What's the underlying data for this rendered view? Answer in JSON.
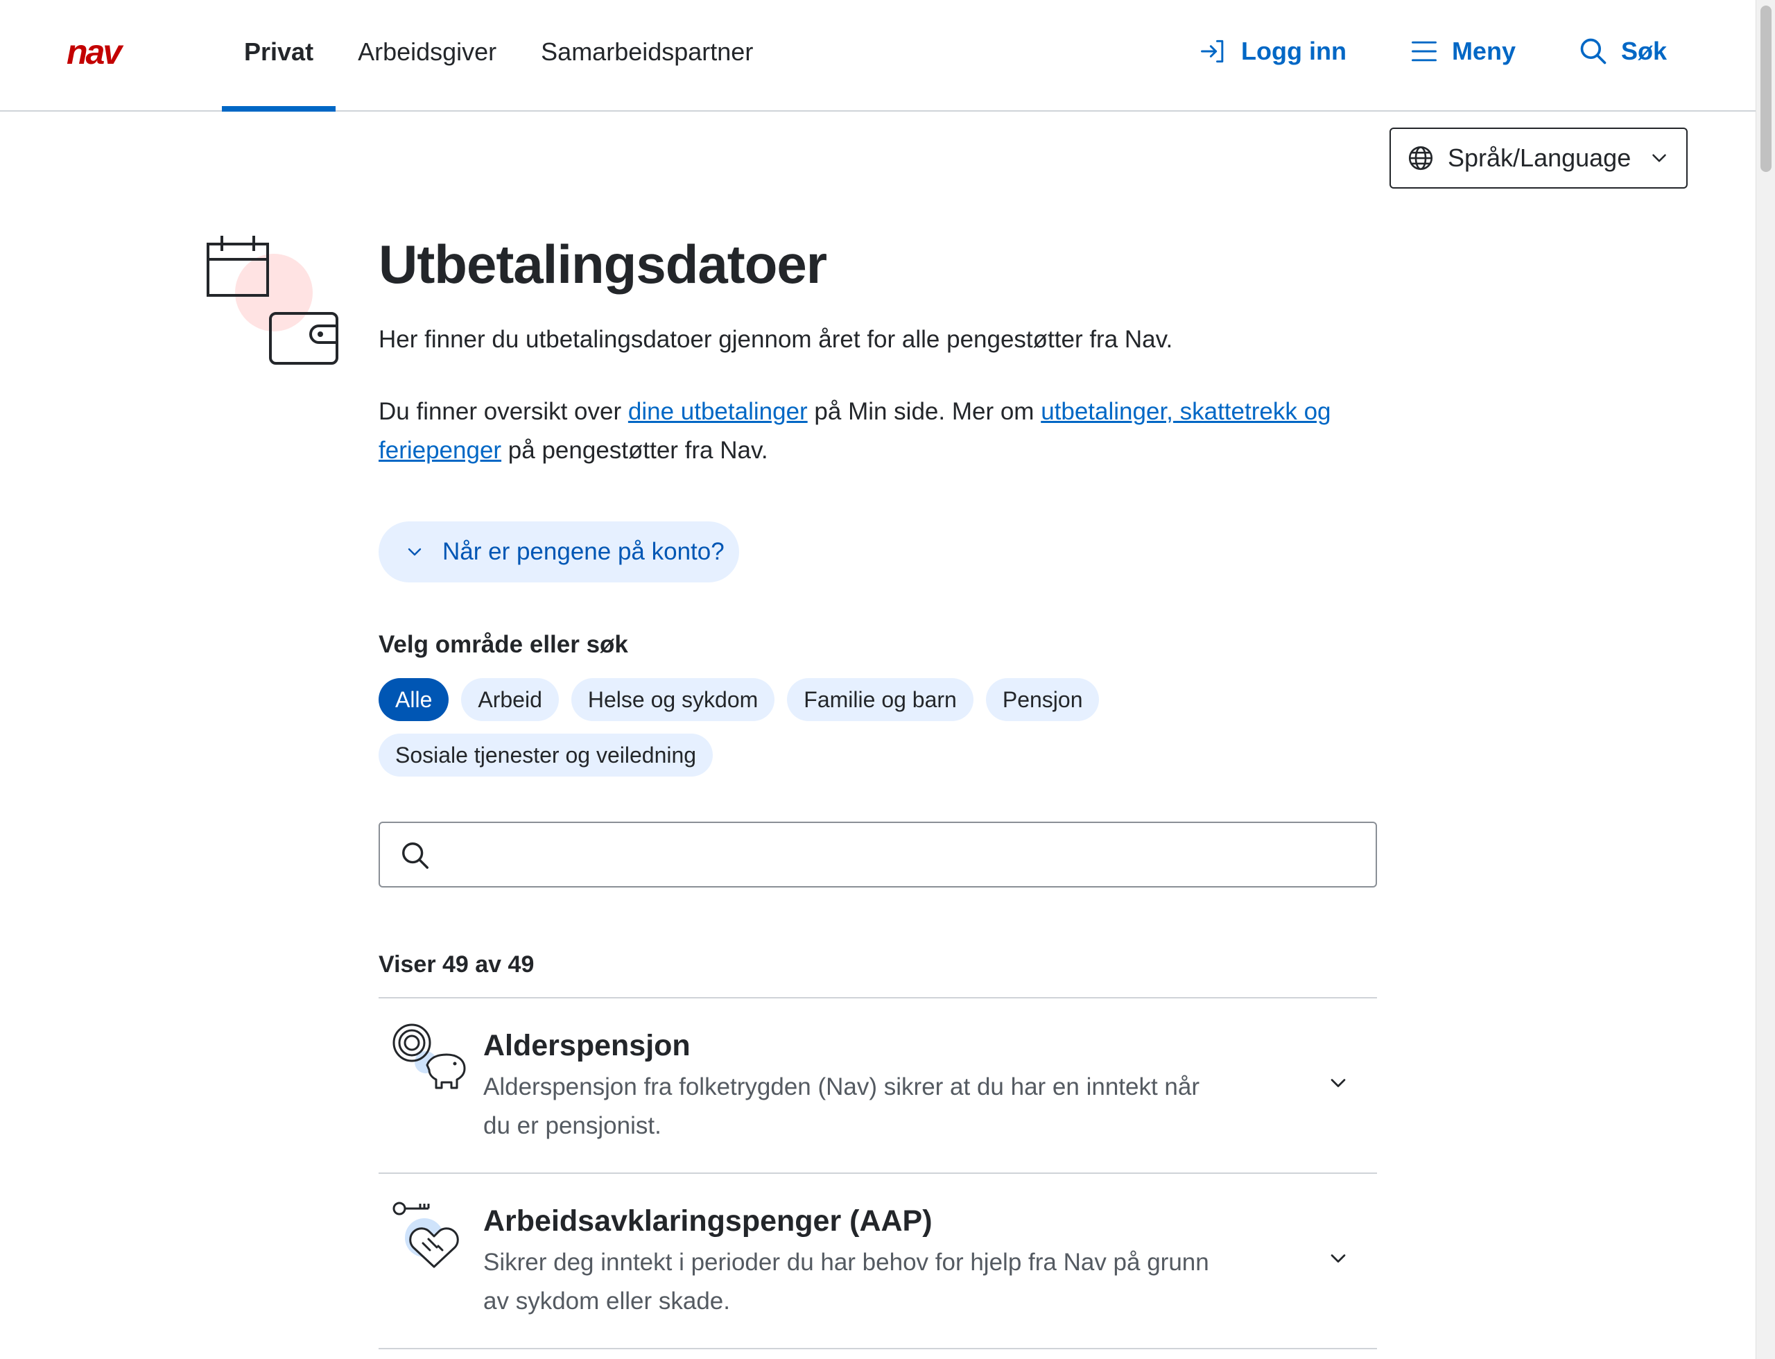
{
  "header": {
    "tabs": [
      {
        "label": "Privat",
        "active": true
      },
      {
        "label": "Arbeidsgiver",
        "active": false
      },
      {
        "label": "Samarbeidspartner",
        "active": false
      }
    ],
    "login_label": "Logg inn",
    "menu_label": "Meny",
    "search_label": "Søk",
    "logo_icon": "nav-logo"
  },
  "language": {
    "label": "Språk/Language"
  },
  "page": {
    "title": "Utbetalingsdatoer",
    "intro": "Her finner du utbetalingsdatoer gjennom året for alle pengestøtter fra Nav.",
    "para_1": "Du finner oversikt over ",
    "link_1": "dine utbetalinger",
    "para_2": " på Min side. Mer om ",
    "link_2": "utbetalinger, skattetrekk og feriepenger",
    "para_3": " på pengestøtter fra Nav.",
    "expand_label": "Når er pengene på konto?"
  },
  "filters": {
    "label": "Velg område eller søk",
    "chips": [
      {
        "label": "Alle",
        "active": true
      },
      {
        "label": "Arbeid",
        "active": false
      },
      {
        "label": "Helse og sykdom",
        "active": false
      },
      {
        "label": "Familie og barn",
        "active": false
      },
      {
        "label": "Pensjon",
        "active": false
      },
      {
        "label": "Sosiale tjenester og veiledning",
        "active": false
      }
    ]
  },
  "search": {
    "value": "",
    "placeholder": ""
  },
  "results": {
    "count_label": "Viser 49 av 49",
    "items": [
      {
        "title": "Alderspensjon",
        "description": "Alderspensjon fra folketrygden (Nav) sikrer at du har en inntekt når du er pensjonist.",
        "icon": "piggy-bank-icon"
      },
      {
        "title": "Arbeidsavklaringspenger (AAP)",
        "description": "Sikrer deg inntekt i perioder du har behov for hjelp fra Nav på grunn av sykdom eller skade.",
        "icon": "key-heart-icon"
      }
    ]
  },
  "colors": {
    "brand_red": "#c30000",
    "link_blue": "#0067c5",
    "chip_bg": "#e6f0ff",
    "chip_active": "#0056b4"
  }
}
